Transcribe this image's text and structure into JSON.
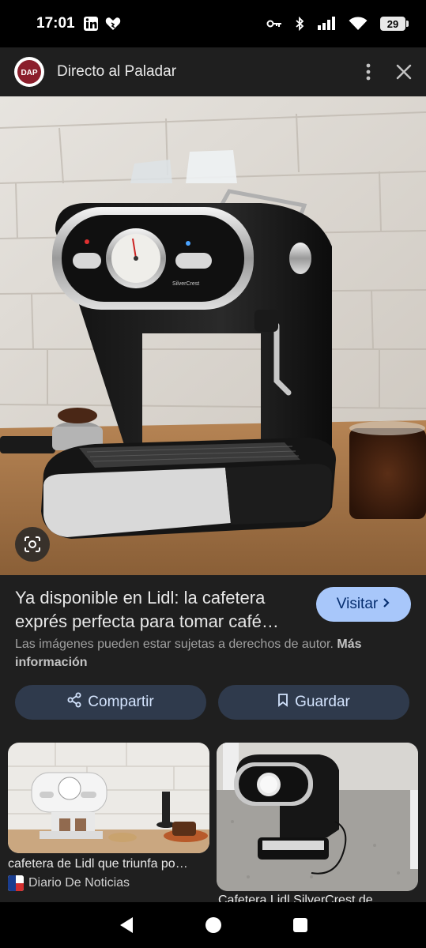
{
  "status_bar": {
    "time": "17:01",
    "battery_level": "29",
    "left_icons": [
      "linkedin-icon",
      "heart-icon"
    ],
    "right_icons": [
      "key-icon",
      "bluetooth-icon",
      "signal-icon",
      "wifi-icon",
      "battery-icon"
    ]
  },
  "header": {
    "logo_text": "DAP",
    "site_name": "Directo al Paladar",
    "more_icon": "more-vert-icon",
    "close_icon": "close-icon"
  },
  "result": {
    "title": "Ya disponible en Lidl: la cafetera exprés perfecta para tomar café…",
    "visit_label": "Visitar",
    "copyright_text": "Las imágenes pueden estar sujetas a derechos de autor.",
    "more_info_label": "Más información",
    "share_label": "Compartir",
    "save_label": "Guardar",
    "machine_brand": "SilverCrest"
  },
  "related": [
    {
      "title": "cafetera de Lidl que triunfa po…",
      "source": "Diario De Noticias"
    },
    {
      "title": "Cafetera Lidl SilverCrest de…",
      "source": ""
    }
  ],
  "colors": {
    "background": "#1f1f1f",
    "visit_button": "#a8c7fa",
    "action_button": "#2f3a4c",
    "logo_bg": "#8b1e2c"
  }
}
